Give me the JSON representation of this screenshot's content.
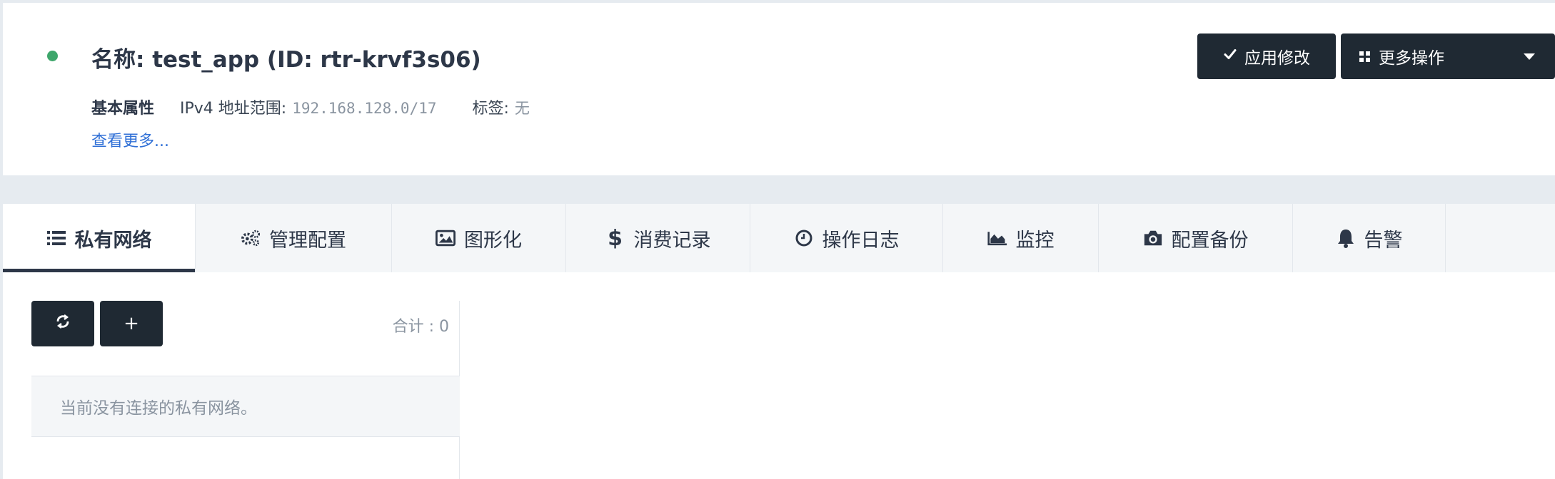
{
  "header": {
    "title": "名称: test_app (ID: rtr-krvf3s06)",
    "status_color": "#3ea66b",
    "section_label": "基本属性",
    "ipv4_label": "IPv4 地址范围:",
    "ipv4_value": "192.168.128.0/17",
    "tags_label": "标签:",
    "tags_value": "无",
    "see_more": "查看更多...",
    "apply_button": "应用修改",
    "more_button": "更多操作"
  },
  "tabs": [
    {
      "label": "私有网络",
      "icon": "list-icon",
      "active": true
    },
    {
      "label": "管理配置",
      "icon": "gears-icon"
    },
    {
      "label": "图形化",
      "icon": "image-icon"
    },
    {
      "label": "消费记录",
      "icon": "dollar-icon"
    },
    {
      "label": "操作日志",
      "icon": "clock-icon"
    },
    {
      "label": "监控",
      "icon": "area-chart-icon"
    },
    {
      "label": "配置备份",
      "icon": "camera-icon"
    },
    {
      "label": "告警",
      "icon": "bell-icon"
    }
  ],
  "content": {
    "refresh_icon": "refresh-icon",
    "add_label": "+",
    "total_text": "合计 : 0",
    "empty_message": "当前没有连接的私有网络。"
  },
  "colors": {
    "dark_button": "#1f2933",
    "link": "#2f6fd6",
    "tab_background": "#f4f6f8"
  }
}
